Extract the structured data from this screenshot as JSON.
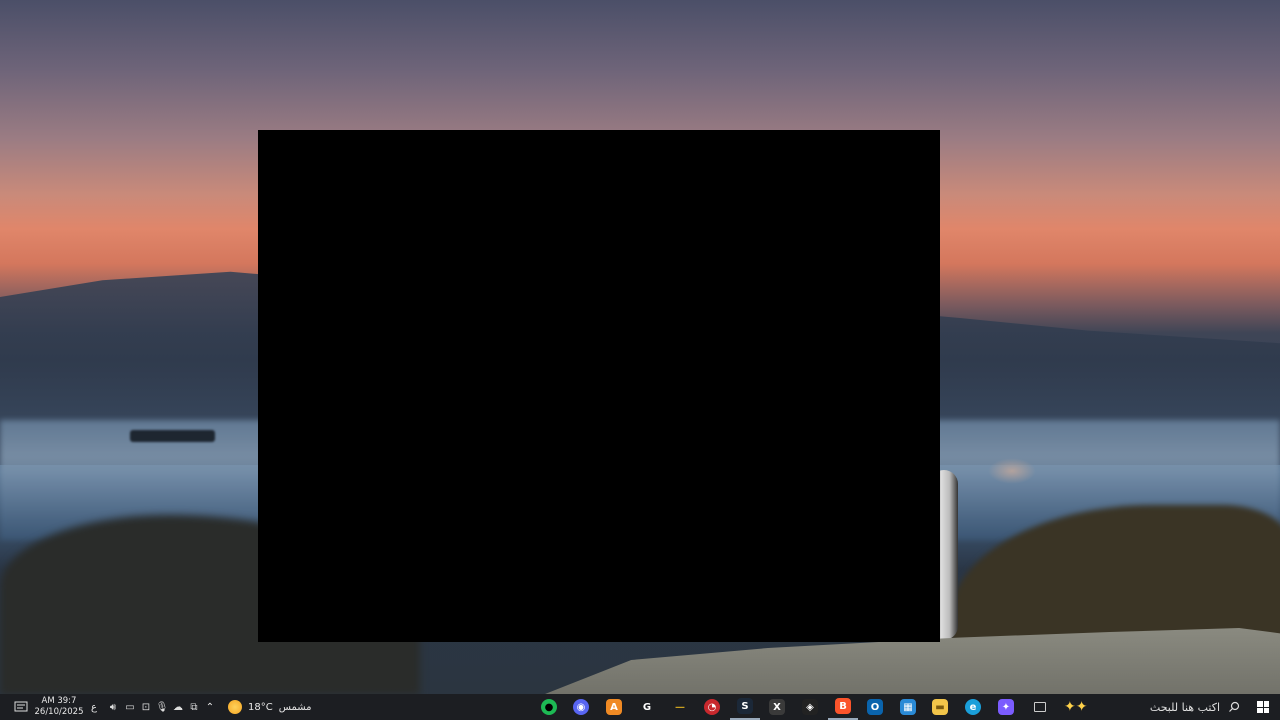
{
  "desktop": {
    "wallpaper": "sunset-sea-rocks-penguin"
  },
  "window": {
    "color": "#000000"
  },
  "taskbar": {
    "clock": {
      "time": "AM 39:7",
      "date": "26/10/2025"
    },
    "language": "ع",
    "weather": {
      "temperature": "18°C",
      "condition": "مشمس"
    },
    "search": {
      "placeholder": "اكتب هنا للبحث"
    },
    "tray_icons": [
      "speaker-icon",
      "display-icon",
      "network-icon",
      "microphone-icon",
      "onedrive-icon",
      "copy-icon",
      "chevron-up-icon"
    ],
    "apps": [
      {
        "name": "spotify",
        "glyph": "●",
        "color": "#1db954"
      },
      {
        "name": "discord",
        "glyph": "◉",
        "color": "#5865f2"
      },
      {
        "name": "ace",
        "glyph": "A",
        "color": "#f08a24"
      },
      {
        "name": "grok",
        "glyph": "G",
        "color": "#1c1e22"
      },
      {
        "name": "folder-shortcut",
        "glyph": "—",
        "color": "#c9a020"
      },
      {
        "name": "speedometer",
        "glyph": "◔",
        "color": "#c8282d"
      },
      {
        "name": "steam",
        "glyph": "S",
        "color": "#1b2838"
      },
      {
        "name": "xbox",
        "glyph": "X",
        "color": "#3a3a3a"
      },
      {
        "name": "capture",
        "glyph": "◈",
        "color": "#222222"
      },
      {
        "name": "brave",
        "glyph": "B",
        "color": "#fb542b"
      },
      {
        "name": "outlook",
        "glyph": "O",
        "color": "#0a64ad"
      },
      {
        "name": "microsoft-store",
        "glyph": "▦",
        "color": "#2a8ad6"
      },
      {
        "name": "file-explorer",
        "glyph": "▬",
        "color": "#f2c54a"
      },
      {
        "name": "edge",
        "glyph": "e",
        "color": "#1a9fda"
      },
      {
        "name": "copilot",
        "glyph": "✦",
        "color": "#7b5cff"
      },
      {
        "name": "task-view",
        "glyph": "▭",
        "color": "#1c1e22"
      }
    ]
  }
}
